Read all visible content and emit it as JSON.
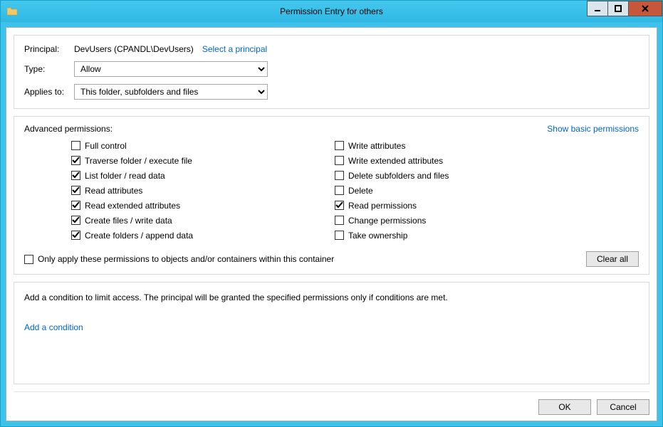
{
  "window": {
    "title": "Permission Entry for others"
  },
  "principal": {
    "label": "Principal:",
    "value": "DevUsers (CPANDL\\DevUsers)",
    "select_link": "Select a principal"
  },
  "type": {
    "label": "Type:",
    "value": "Allow"
  },
  "applies_to": {
    "label": "Applies to:",
    "value": "This folder, subfolders and files"
  },
  "advanced": {
    "heading": "Advanced permissions:",
    "show_basic_link": "Show basic permissions",
    "left": [
      {
        "label": "Full control",
        "checked": false
      },
      {
        "label": "Traverse folder / execute file",
        "checked": true
      },
      {
        "label": "List folder / read data",
        "checked": true
      },
      {
        "label": "Read attributes",
        "checked": true
      },
      {
        "label": "Read extended attributes",
        "checked": true
      },
      {
        "label": "Create files / write data",
        "checked": true
      },
      {
        "label": "Create folders / append data",
        "checked": true
      }
    ],
    "right": [
      {
        "label": "Write attributes",
        "checked": false
      },
      {
        "label": "Write extended attributes",
        "checked": false
      },
      {
        "label": "Delete subfolders and files",
        "checked": false
      },
      {
        "label": "Delete",
        "checked": false
      },
      {
        "label": "Read permissions",
        "checked": true
      },
      {
        "label": "Change permissions",
        "checked": false
      },
      {
        "label": "Take ownership",
        "checked": false
      }
    ],
    "only_apply": {
      "label": "Only apply these permissions to objects and/or containers within this container",
      "checked": false
    },
    "clear_all": "Clear all"
  },
  "condition": {
    "text": "Add a condition to limit access. The principal will be granted the specified permissions only if conditions are met.",
    "add_link": "Add a condition"
  },
  "buttons": {
    "ok": "OK",
    "cancel": "Cancel"
  }
}
